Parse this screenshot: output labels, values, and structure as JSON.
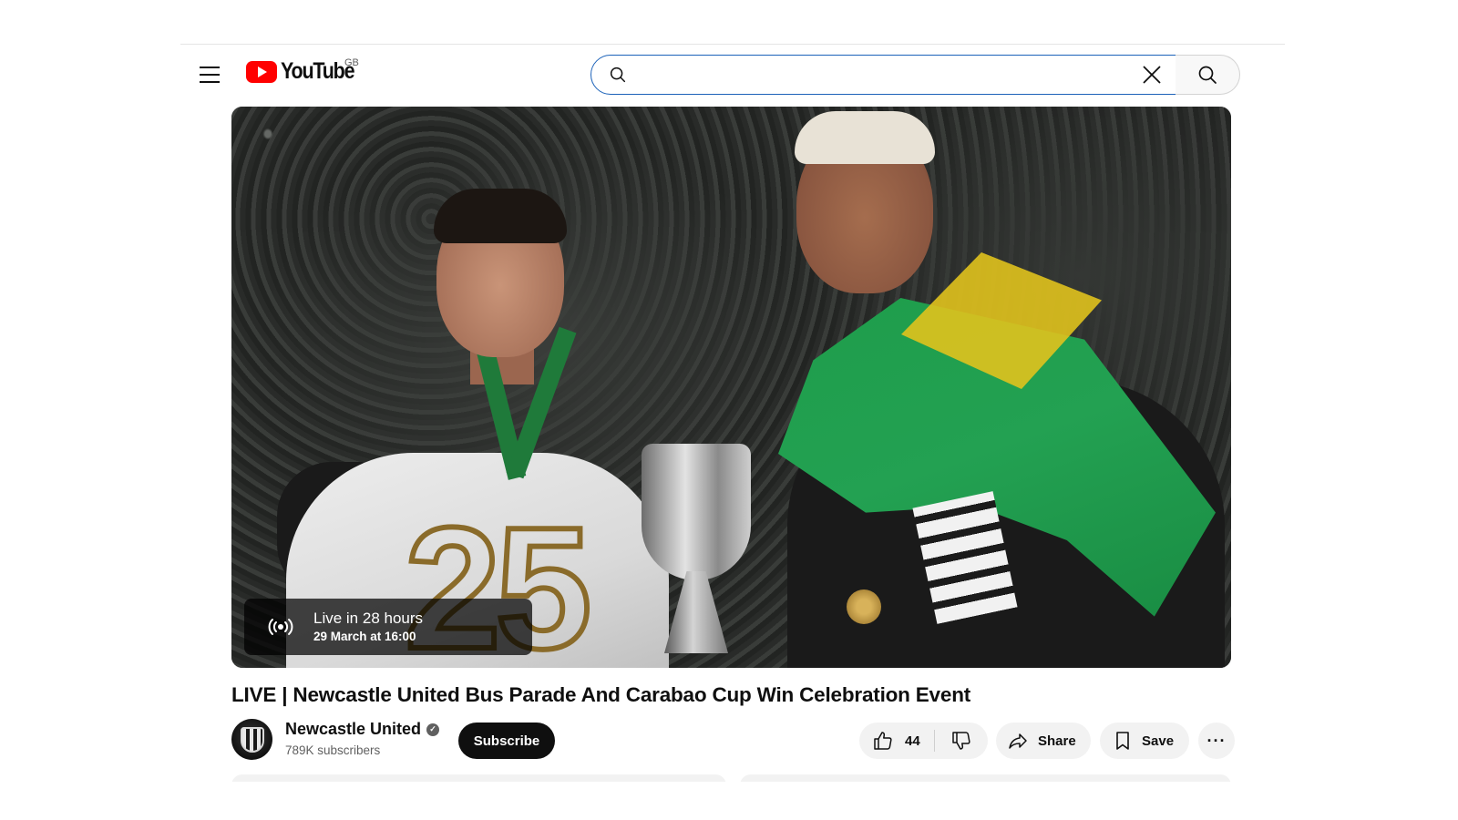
{
  "masthead": {
    "logo_text": "YouTube",
    "region": "GB",
    "search": {
      "value": "",
      "placeholder": ""
    }
  },
  "player": {
    "live_status": "Live in 28 hours",
    "scheduled": "29 March at 16:00"
  },
  "video": {
    "title": "LIVE | Newcastle United Bus Parade And Carabao Cup Win Celebration Event"
  },
  "channel": {
    "name": "Newcastle United",
    "subscribers": "789K subscribers",
    "verified": true
  },
  "actions": {
    "subscribe_label": "Subscribe",
    "like_count": "44",
    "share_label": "Share",
    "save_label": "Save",
    "more_label": "···"
  },
  "colors": {
    "brand_red": "#ff0000",
    "search_focus": "#1c62b9",
    "button_dark": "#0f0f0f",
    "pill_bg": "#f2f2f2"
  },
  "icons": [
    "menu-icon",
    "youtube-logo",
    "search-icon",
    "close-icon",
    "live-broadcast-icon",
    "verified-icon",
    "thumbs-up-icon",
    "thumbs-down-icon",
    "share-icon",
    "bookmark-icon",
    "more-icon"
  ]
}
